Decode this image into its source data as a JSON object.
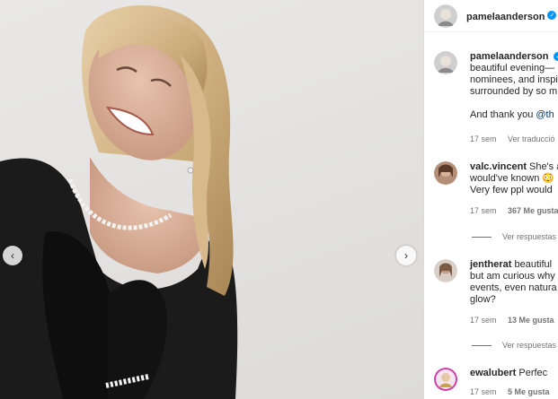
{
  "post": {
    "author": "pamelaanderson",
    "verified": true,
    "caption_lines": [
      "beautiful evening—",
      "nominees, and inspi",
      "surrounded by so m"
    ],
    "caption_thanks_prefix": "And thank you ",
    "caption_mention": "@th",
    "time": "17 sem",
    "translate_label": "Ver traducció"
  },
  "comments": [
    {
      "user": "valc.vincent",
      "text_lines": [
        "She's a",
        "would've known 😳",
        "Very few ppl would"
      ],
      "time": "17 sem",
      "likes": "367 Me gusta",
      "replies_label": "Ver respuestas"
    },
    {
      "user": "jentherat",
      "text_lines": [
        "beautiful",
        "but am curious why",
        "events, even natura",
        "glow?"
      ],
      "time": "17 sem",
      "likes": "13 Me gusta",
      "replies_label": "Ver respuestas"
    },
    {
      "user": "ewalubert",
      "text_lines": [
        "Perfec"
      ],
      "time": "17 sem",
      "likes": "5 Me gusta"
    }
  ],
  "icons": {
    "prev": "chevron-left-icon",
    "next": "chevron-right-icon",
    "verified": "verified-badge-icon"
  },
  "colors": {
    "verified": "#0095f6",
    "mention": "#00376b",
    "meta": "#737373"
  }
}
